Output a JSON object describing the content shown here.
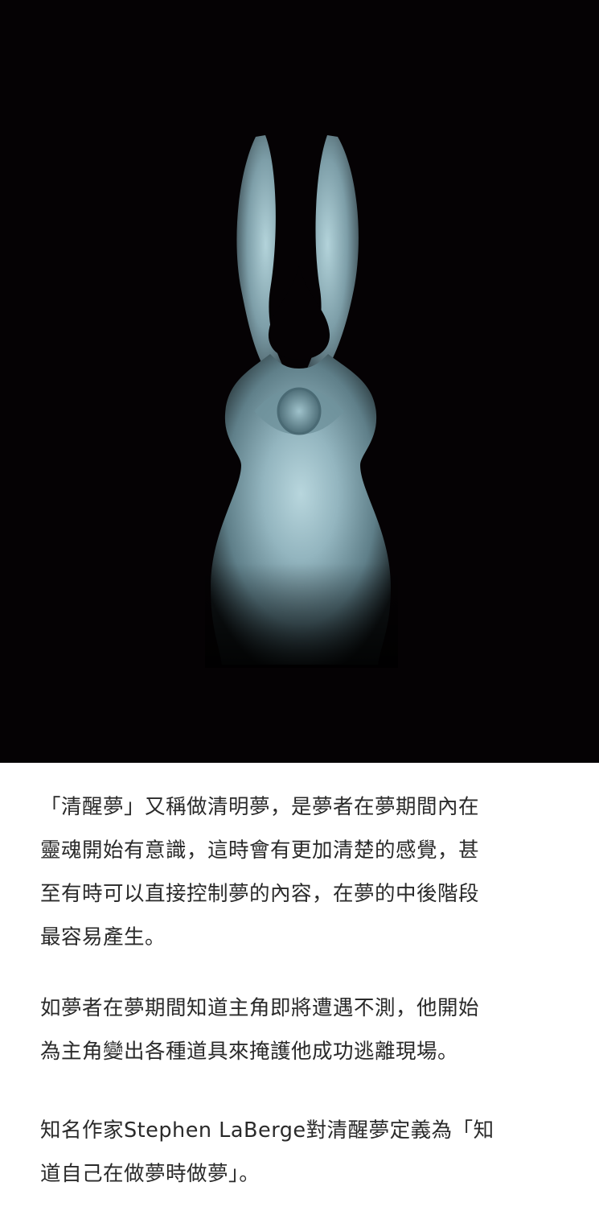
{
  "paragraphs": [
    "「清醒夢」又稱做清明夢，是夢者在夢期間內在\n靈魂開始有意識，這時會有更加清楚的感覺，甚\n至有時可以直接控制夢的內容，在夢的中後階段\n最容易產生。",
    "如夢者在夢期間知道主角即將遭遇不測，他開始\n為主角變出各種道具來掩護他成功逃離現場。",
    "知名作家Stephen LaBerge對清醒夢定義為「知\n道自己在做夢時做夢」。"
  ],
  "illustration": {
    "subject": "rabbit-silhouette-with-eye",
    "background_color": "#050204",
    "figure_color": "#8fb0bb"
  }
}
